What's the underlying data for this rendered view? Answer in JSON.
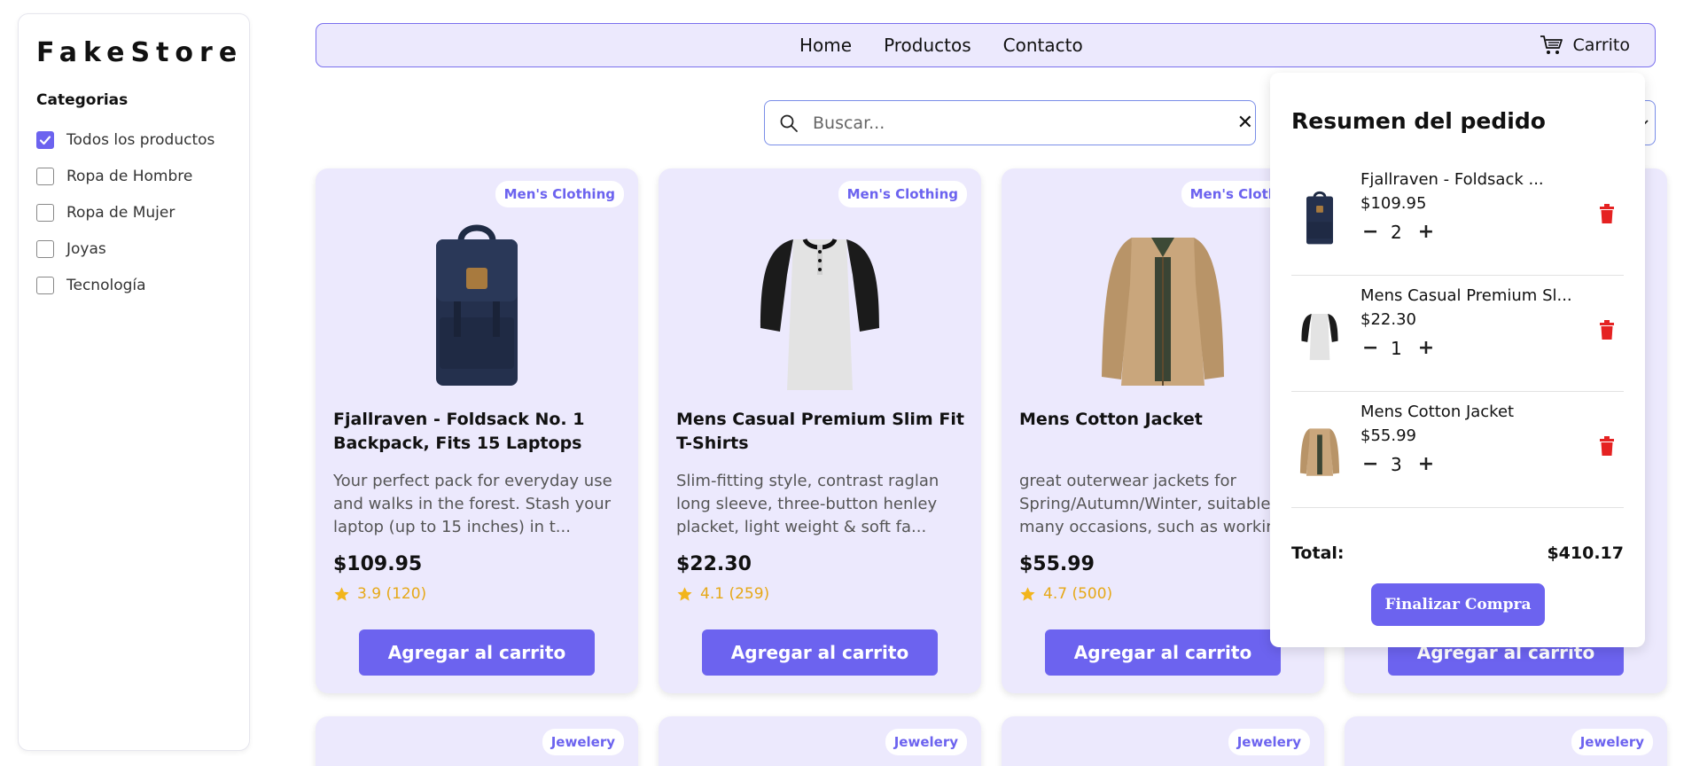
{
  "sidebar": {
    "brand": "FakeStore",
    "categories_title": "Categorias",
    "categories": [
      {
        "label": "Todos los productos",
        "checked": true
      },
      {
        "label": "Ropa de Hombre",
        "checked": false
      },
      {
        "label": "Ropa de Mujer",
        "checked": false
      },
      {
        "label": "Joyas",
        "checked": false
      },
      {
        "label": "Tecnología",
        "checked": false
      }
    ]
  },
  "navbar": {
    "links": [
      "Home",
      "Productos",
      "Contacto"
    ],
    "cart_label": "Carrito",
    "cart_icon": "cart-icon"
  },
  "search": {
    "placeholder": "Buscar...",
    "value": ""
  },
  "products": [
    {
      "badge": "Men's Clothing",
      "title": "Fjallraven - Foldsack No. 1 Backpack, Fits 15 Laptops",
      "description": "Your perfect pack for everyday use and walks in the forest. Stash your laptop (up to 15 inches) in t...",
      "price": "$109.95",
      "rating": "3.9 (120)",
      "button": "Agregar al carrito"
    },
    {
      "badge": "Men's Clothing",
      "title": "Mens Casual Premium Slim Fit T-Shirts",
      "description": "Slim-fitting style, contrast raglan long sleeve, three-button henley placket, light weight & soft fa...",
      "price": "$22.30",
      "rating": "4.1 (259)",
      "button": "Agregar al carrito"
    },
    {
      "badge": "Men's Clothing",
      "title": "Mens Cotton Jacket",
      "description": "great outerwear jackets for Spring/Autumn/Winter, suitable for many occasions, such as working, hiki...",
      "price": "$55.99",
      "rating": "4.7 (500)",
      "button": "Agregar al carrito"
    },
    {
      "badge": "",
      "title": "",
      "description": "",
      "price": "",
      "rating": "",
      "button": "Agregar al carrito"
    }
  ],
  "products_row2_badges": [
    "Jewelery",
    "Jewelery",
    "Jewelery",
    "Jewelery"
  ],
  "cart": {
    "title": "Resumen del pedido",
    "items": [
      {
        "name": "Fjallraven - Foldsack ...",
        "price": "$109.95",
        "qty": "2"
      },
      {
        "name": "Mens Casual Premium Sl...",
        "price": "$22.30",
        "qty": "1"
      },
      {
        "name": "Mens Cotton Jacket",
        "price": "$55.99",
        "qty": "3"
      }
    ],
    "total_label": "Total:",
    "total_value": "$410.17",
    "checkout_label": "Finalizar Compra"
  },
  "colors": {
    "accent": "#6c63ef",
    "card_bg": "#ece9fd",
    "rating": "#e6a817",
    "trash": "#e52222"
  }
}
